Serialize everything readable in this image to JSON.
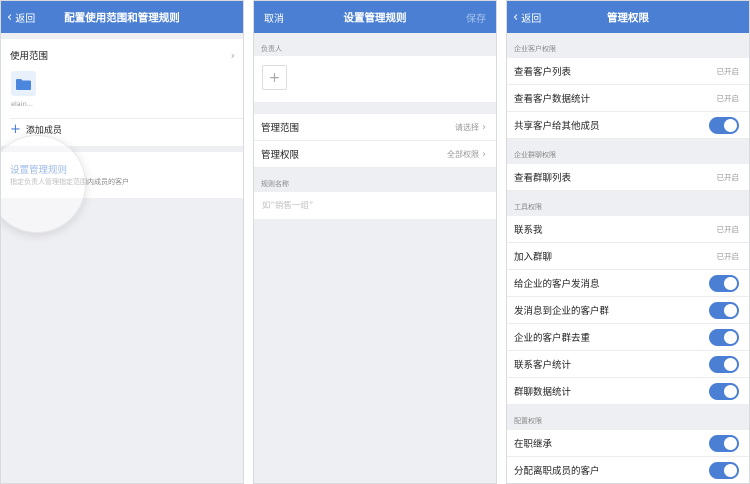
{
  "panel1": {
    "back_label": "返回",
    "title": "配置使用范围和管理规则",
    "scope_label": "使用范围",
    "folder_name": "elain...",
    "add_member_label": "添加成员",
    "rule_title": "设置管理规则",
    "rule_desc": "指定负责人管理指定范围内成员的客户"
  },
  "panel2": {
    "cancel_label": "取消",
    "title": "设置管理规则",
    "save_label": "保存",
    "owner_label": "负责人",
    "rows": [
      {
        "label": "管理范围",
        "value": "请选择"
      },
      {
        "label": "管理权限",
        "value": "全部权限"
      }
    ],
    "rule_name_label": "规则名称",
    "rule_name_placeholder": "如“销售一组”"
  },
  "panel3": {
    "back_label": "返回",
    "title": "管理权限",
    "sections": [
      {
        "title": "企业客户权限",
        "items": [
          {
            "label": "查看客户列表",
            "status": "已开启",
            "toggle": false
          },
          {
            "label": "查看客户数据统计",
            "status": "已开启",
            "toggle": false
          },
          {
            "label": "共享客户给其他成员",
            "status": "",
            "toggle": true
          }
        ]
      },
      {
        "title": "企业群聊权限",
        "items": [
          {
            "label": "查看群聊列表",
            "status": "已开启",
            "toggle": false
          }
        ]
      },
      {
        "title": "工具权限",
        "items": [
          {
            "label": "联系我",
            "status": "已开启",
            "toggle": false
          },
          {
            "label": "加入群聊",
            "status": "已开启",
            "toggle": false
          },
          {
            "label": "给企业的客户发消息",
            "status": "",
            "toggle": true
          },
          {
            "label": "发消息到企业的客户群",
            "status": "",
            "toggle": true
          },
          {
            "label": "企业的客户群去重",
            "status": "",
            "toggle": true
          },
          {
            "label": "联系客户统计",
            "status": "",
            "toggle": true
          },
          {
            "label": "群聊数据统计",
            "status": "",
            "toggle": true
          }
        ]
      },
      {
        "title": "配置权限",
        "items": [
          {
            "label": "在职继承",
            "status": "",
            "toggle": true
          },
          {
            "label": "分配离职成员的客户",
            "status": "",
            "toggle": true
          }
        ]
      }
    ]
  },
  "colors": {
    "accent": "#4a7fd3",
    "background": "#eeeff2"
  }
}
